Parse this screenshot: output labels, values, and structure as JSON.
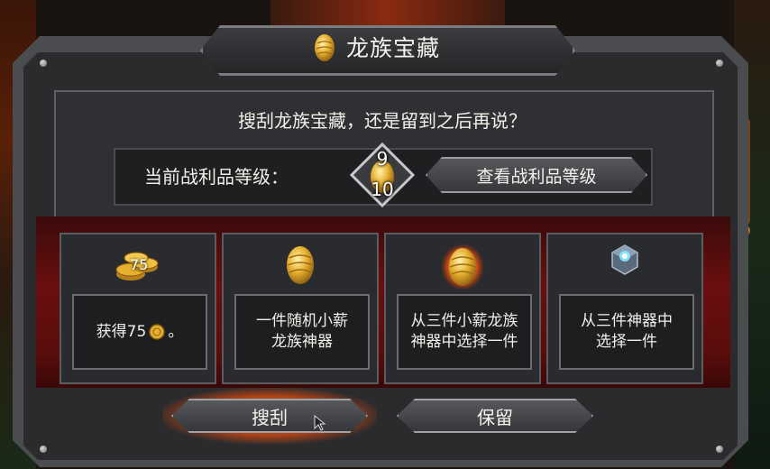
{
  "dialog": {
    "title": "龙族宝藏",
    "prompt": "搜刮龙族宝藏，还是留到之后再说？",
    "loot_level": {
      "label": "当前战利品等级：",
      "current": "9",
      "max": "10",
      "view_button": "查看战利品等级"
    },
    "rewards": [
      {
        "icon": "gold-coins-icon",
        "icon_value": "75",
        "text_prefix": "获得75",
        "text_suffix": "。",
        "inline_icon": "coin-icon"
      },
      {
        "icon": "golden-egg-icon",
        "text_line1": "一件随机小薪",
        "text_line2": "龙族神器"
      },
      {
        "icon": "glowing-egg-icon",
        "text_line1": "从三件小薪龙族",
        "text_line2": "神器中选择一件"
      },
      {
        "icon": "artifact-chest-icon",
        "text_line1": "从三件神器中",
        "text_line2": "选择一件"
      }
    ],
    "buttons": {
      "loot": "搜刮",
      "keep": "保留"
    }
  },
  "colors": {
    "accent_glow": "#ff7a1e",
    "gold": "#e8b030",
    "panel_bg": "#2b2b2d",
    "red_band": "#6a0f0f"
  }
}
